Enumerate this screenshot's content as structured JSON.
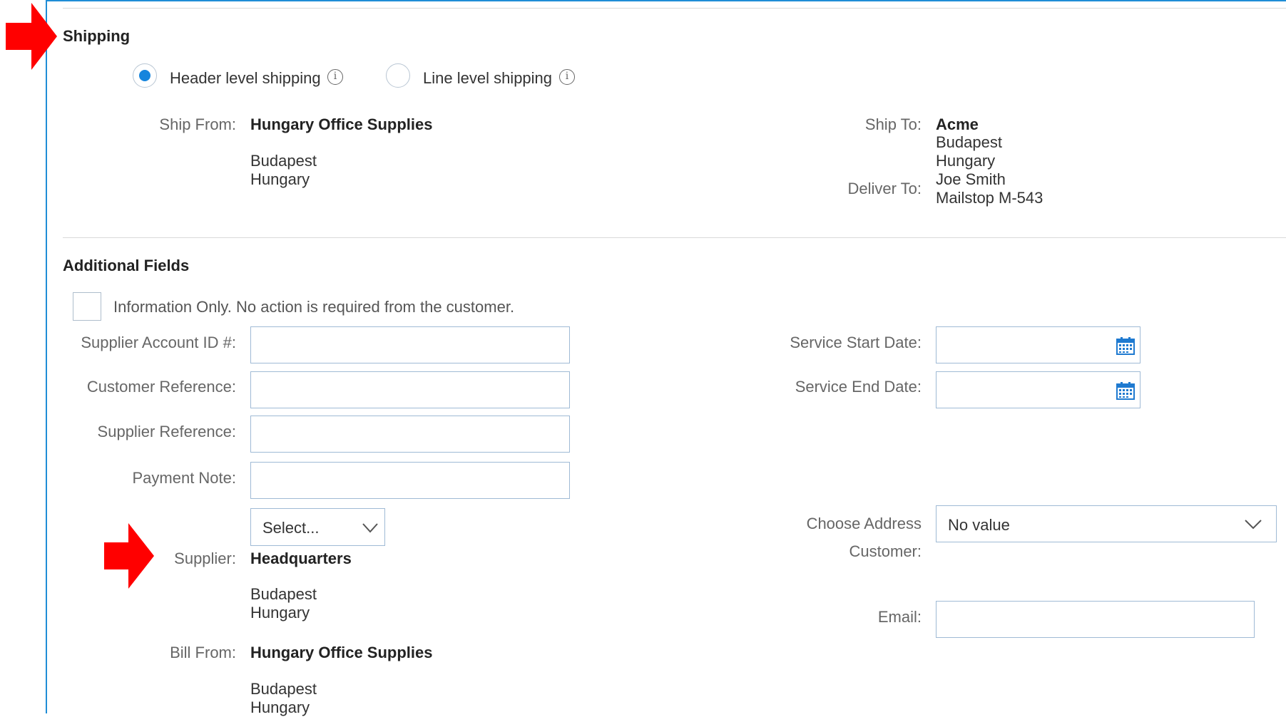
{
  "shipping": {
    "title": "Shipping",
    "options": [
      {
        "label": "Header level shipping",
        "selected": true,
        "info_icon": "info-icon"
      },
      {
        "label": "Line level shipping",
        "selected": false,
        "info_icon": "info-icon"
      }
    ],
    "ship_from": {
      "label": "Ship From:",
      "name": "Hungary Office Supplies",
      "city": "Budapest",
      "country": "Hungary"
    },
    "ship_to": {
      "label": "Ship To:",
      "name": "Acme",
      "city": "Budapest",
      "country": "Hungary"
    },
    "deliver_to": {
      "label": "Deliver To:",
      "person": "Joe Smith",
      "mailstop": "Mailstop M-543"
    }
  },
  "additional_fields": {
    "title": "Additional Fields",
    "info_only_label": "Information Only. No action is required from the customer.",
    "supplier_account_id": {
      "label": "Supplier Account ID #:",
      "value": ""
    },
    "customer_reference": {
      "label": "Customer Reference:",
      "value": ""
    },
    "supplier_reference": {
      "label": "Supplier Reference:",
      "value": ""
    },
    "payment_note": {
      "label": "Payment Note:",
      "value": ""
    },
    "service_start_date": {
      "label": "Service Start Date:",
      "value": "",
      "icon": "calendar-icon"
    },
    "service_end_date": {
      "label": "Service End Date:",
      "value": "",
      "icon": "calendar-icon"
    },
    "supplier": {
      "label": "Supplier:",
      "select_value": "Select...",
      "name": "Headquarters",
      "city": "Budapest",
      "country": "Hungary"
    },
    "choose_address": {
      "label_line1": "Choose Address",
      "label_line2": "Customer:",
      "select_value": "No value"
    },
    "email": {
      "label": "Email:",
      "value": ""
    },
    "bill_from": {
      "label": "Bill From:",
      "name": "Hungary Office Supplies",
      "city": "Budapest",
      "country": "Hungary"
    }
  },
  "colors": {
    "accent": "#1f8dd6",
    "radio_selected": "#1685dd",
    "annotation_arrow": "#ff0000",
    "label_text": "#666666"
  }
}
